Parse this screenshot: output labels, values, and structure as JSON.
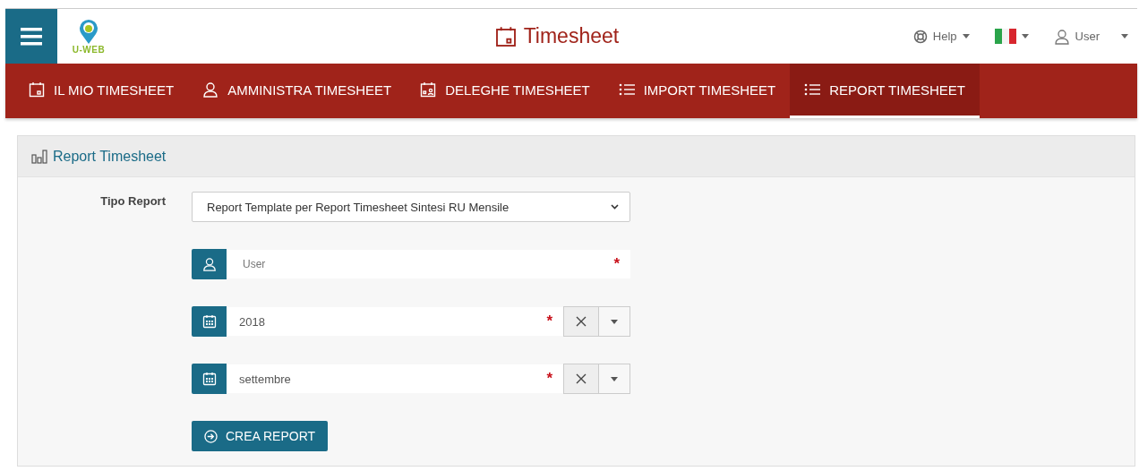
{
  "header": {
    "logo_text": "U-WEB",
    "title": "Timesheet",
    "help": "Help",
    "user": "User"
  },
  "nav": [
    {
      "label": "IL MIO TIMESHEET",
      "kind": "calendar",
      "selected": false
    },
    {
      "label": "AMMINISTRA TIMESHEET",
      "kind": "person",
      "selected": false
    },
    {
      "label": "DELEGHE TIMESHEET",
      "kind": "delegate",
      "selected": false
    },
    {
      "label": "IMPORT TIMESHEET",
      "kind": "list",
      "selected": false
    },
    {
      "label": "REPORT TIMESHEET",
      "kind": "list",
      "selected": true
    }
  ],
  "panel": {
    "title": "Report Timesheet",
    "fields": [
      {
        "kind": "select",
        "label": "Tipo Report",
        "value": "Report Template per Report Timesheet Sintesi RU Mensile"
      },
      {
        "kind": "text",
        "placeholder": "User",
        "required_mark": "*"
      },
      {
        "kind": "combo",
        "value": "2018",
        "required_mark": "*"
      },
      {
        "kind": "combo",
        "value": "settembre",
        "required_mark": "*"
      }
    ],
    "button": "CREA REPORT"
  }
}
